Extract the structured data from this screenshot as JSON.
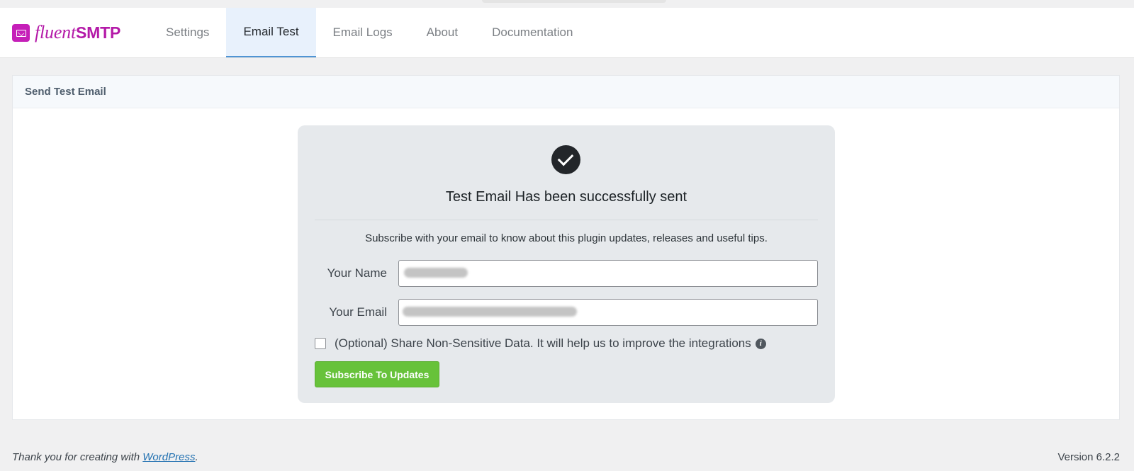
{
  "brand": {
    "name_light": "fluent",
    "name_bold": "SMTP",
    "color": "#b41aa8"
  },
  "nav": {
    "items": [
      {
        "label": "Settings"
      },
      {
        "label": "Email Test"
      },
      {
        "label": "Email Logs"
      },
      {
        "label": "About"
      },
      {
        "label": "Documentation"
      }
    ],
    "active": "Email Test"
  },
  "panel": {
    "title": "Send Test Email"
  },
  "success": {
    "title": "Test Email Has been successfully sent",
    "subscribe_text": "Subscribe with your email to know about this plugin updates, releases and useful tips."
  },
  "form": {
    "name_label": "Your Name",
    "email_label": "Your Email",
    "optin_label": "(Optional) Share Non-Sensitive Data. It will help us to improve the integrations",
    "optin_checked": false,
    "submit_label": "Subscribe To Updates"
  },
  "footer": {
    "thanks_prefix": "Thank you for creating with ",
    "thanks_link": "WordPress",
    "thanks_suffix": ".",
    "version": "Version 6.2.2"
  },
  "colors": {
    "accent": "#4f94d4",
    "success_button": "#67c23a",
    "active_tab_bg": "#e8f1fc"
  }
}
